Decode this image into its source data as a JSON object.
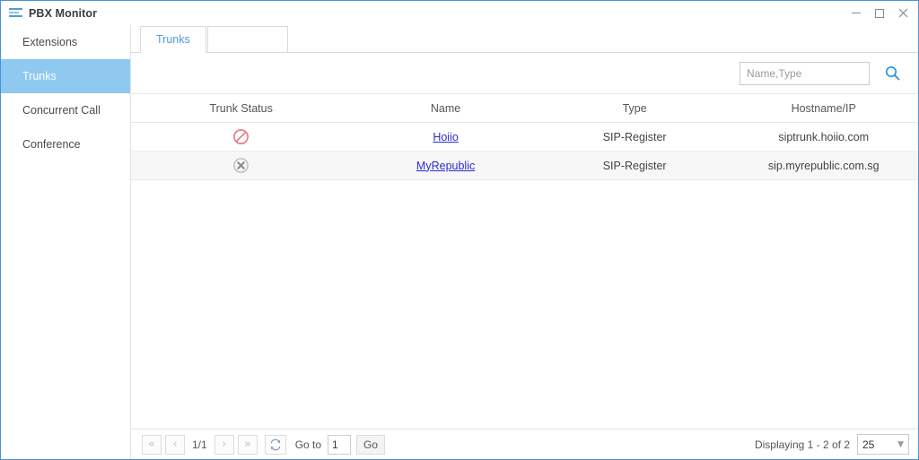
{
  "window": {
    "title": "PBX Monitor",
    "icon": "stripes-icon",
    "controls": {
      "minimize": "minimize-icon",
      "maximize": "maximize-icon",
      "close": "close-icon"
    }
  },
  "sidebar": {
    "items": [
      {
        "label": "Extensions",
        "active": false
      },
      {
        "label": "Trunks",
        "active": true
      },
      {
        "label": "Concurrent Call",
        "active": false
      },
      {
        "label": "Conference",
        "active": false
      }
    ]
  },
  "tabs": [
    {
      "label": "Trunks",
      "active": true
    }
  ],
  "search": {
    "placeholder": "Name,Type",
    "value": "",
    "button_icon": "search-icon"
  },
  "table": {
    "columns": [
      "Trunk Status",
      "Name",
      "Type",
      "Hostname/IP"
    ],
    "rows": [
      {
        "status_icon": "prohibited-icon",
        "status_color": "#e8737f",
        "name": "Hoiio",
        "type": "SIP-Register",
        "host": "siptrunk.hoiio.com"
      },
      {
        "status_icon": "circle-x-icon",
        "status_color": "#a6a6a6",
        "name": "MyRepublic",
        "type": "SIP-Register",
        "host": "sip.myrepublic.com.sg"
      }
    ]
  },
  "pager": {
    "first_label": "«",
    "prev_label": "‹",
    "page_indicator": "1/1",
    "next_label": "›",
    "last_label": "»",
    "refresh_icon": "refresh-icon",
    "goto_label": "Go to",
    "goto_value": "1",
    "go_label": "Go",
    "displaying": "Displaying 1 - 2 of 2",
    "page_size": "25",
    "page_size_caret": "▼"
  },
  "colors": {
    "accent": "#4a9ce0",
    "window_border": "#4a90d9",
    "sidebar_active_bg": "#8fc9f0",
    "link": "#2b2bd4"
  }
}
